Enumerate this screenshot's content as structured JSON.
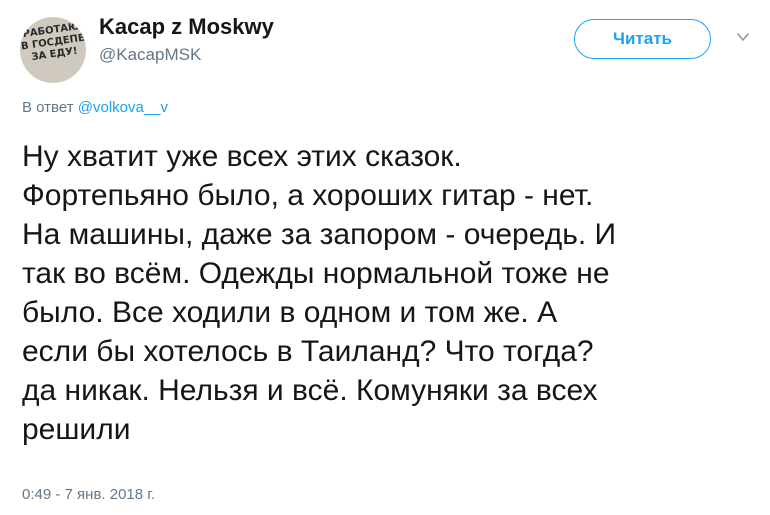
{
  "author": {
    "avatar_text": "РАБОТАЮ\nВ ГОСДЕПЕ\nЗА ЕДУ!",
    "display_name": "Kacap z Moskwy",
    "handle": "@KacapMSK"
  },
  "actions": {
    "follow_label": "Читать",
    "menu_icon": "chevron-down-icon"
  },
  "reply": {
    "prefix": "В ответ ",
    "mention": "@volkova__v"
  },
  "tweet": {
    "lines": [
      "Ну хватит уже всех этих сказок.",
      "Фортепьяно было, а хороших гитар - нет.",
      "На машины, даже за запором - очередь. И",
      "так во всём. Одежды нормальной тоже не",
      "было. Все ходили в одном и том же. А",
      "если бы хотелось в Таиланд?  Что тогда?",
      "да никак. Нельзя и всё. Комуняки за всех",
      "решили"
    ]
  },
  "timestamp": "0:49 - 7 янв. 2018 г.",
  "colors": {
    "accent": "#1da1f2",
    "secondary_text": "#657786",
    "primary_text": "#14171a"
  }
}
